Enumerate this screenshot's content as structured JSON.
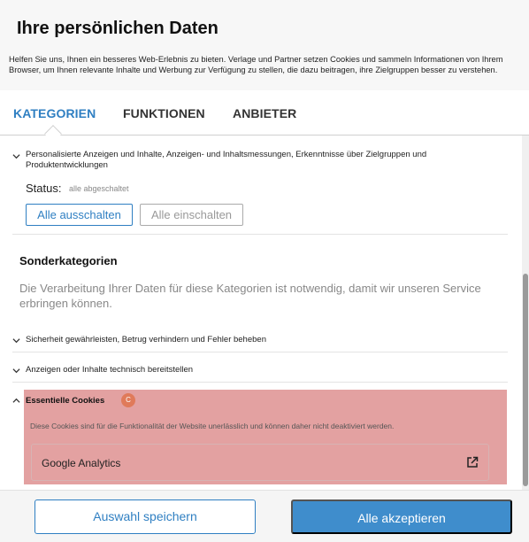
{
  "header": {
    "title": "Ihre persönlichen Daten",
    "intro": "Helfen Sie uns, Ihnen ein besseres Web-Erlebnis zu bieten. Verlage und Partner setzen Cookies und sammeln Informationen von Ihrem Browser, um Ihnen relevante Inhalte und Werbung zur Verfügung zu stellen, die dazu beitragen, ihre Zielgruppen besser zu verstehen."
  },
  "tabs": [
    {
      "label": "KATEGORIEN",
      "active": true
    },
    {
      "label": "FUNKTIONEN",
      "active": false
    },
    {
      "label": "ANBIETER",
      "active": false
    }
  ],
  "categories": {
    "personalized": {
      "label": "Personalisierte Anzeigen und Inhalte, Anzeigen- und Inhaltsmessungen, Erkenntnisse über Zielgruppen und Produktentwicklungen",
      "status_label": "Status:",
      "status_value": "alle abgeschaltet",
      "btn_all_off": "Alle ausschalten",
      "btn_all_on": "Alle einschalten"
    },
    "special": {
      "title": "Sonderkategorien",
      "description": "Die Verarbeitung Ihrer Daten für diese Kategorien ist notwendig, damit wir unseren Service erbringen können.",
      "items": [
        {
          "label": "Sicherheit gewährleisten, Betrug verhindern und Fehler beheben"
        },
        {
          "label": "Anzeigen oder Inhalte technisch bereitstellen"
        }
      ]
    },
    "essential": {
      "title": "Essentielle Cookies",
      "badge": "C",
      "description": "Diese Cookies sind für die Funktionalität der Website unerlässlich und können daher nicht deaktiviert werden.",
      "vendor": "Google Analytics"
    }
  },
  "footer": {
    "save_label": "Auswahl speichern",
    "accept_label": "Alle akzeptieren"
  },
  "colors": {
    "accent": "#2f7fc2",
    "highlight": "#e3a1a1",
    "badge": "#e07a5a"
  },
  "icons": {
    "collapsed": "chevron-down-icon",
    "expanded": "chevron-up-icon",
    "external": "external-link-icon"
  }
}
